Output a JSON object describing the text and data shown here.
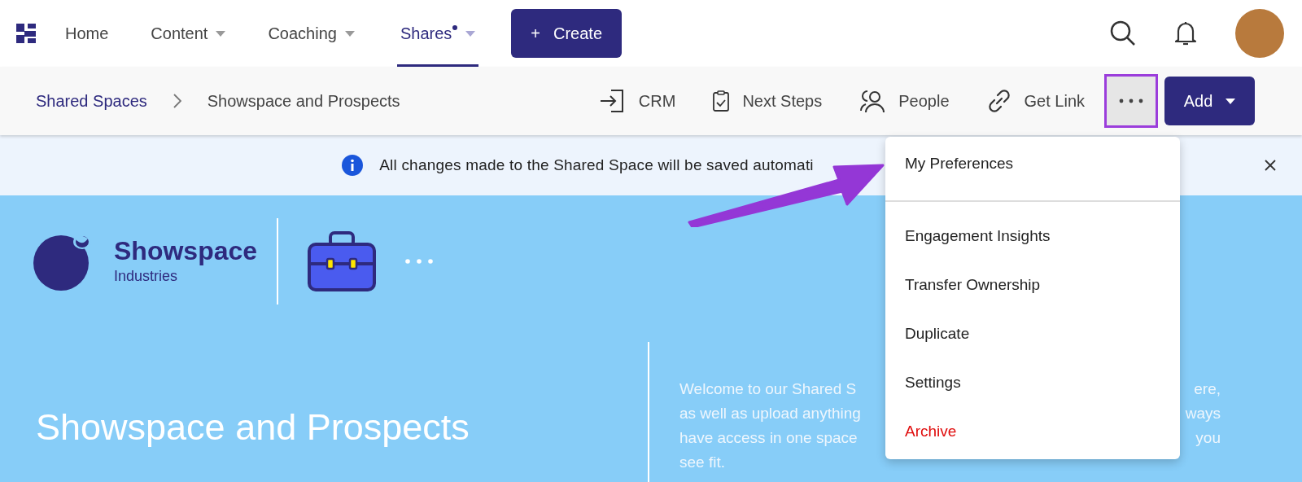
{
  "nav": {
    "items": [
      {
        "label": "Home",
        "selected": false,
        "has_caret": false,
        "dot": false
      },
      {
        "label": "Content",
        "selected": false,
        "has_caret": true,
        "dot": false
      },
      {
        "label": "Coaching",
        "selected": false,
        "has_caret": true,
        "dot": false
      },
      {
        "label": "Shares",
        "selected": true,
        "has_caret": true,
        "dot": true
      }
    ],
    "create_button": {
      "icon": "+",
      "label": "Create"
    }
  },
  "toolbar": {
    "breadcrumbs": [
      "Shared Spaces",
      "Showspace and Prospects"
    ],
    "actions": [
      {
        "kind": "crm",
        "label": "CRM"
      },
      {
        "kind": "steps",
        "label": "Next Steps"
      },
      {
        "kind": "people",
        "label": "People"
      },
      {
        "kind": "link",
        "label": "Get Link"
      }
    ],
    "more_button": {
      "highlighted": true
    },
    "add_button": {
      "label": "Add"
    }
  },
  "banner": {
    "text": "All changes made to the Shared Space will be saved automati"
  },
  "menu": {
    "items": [
      {
        "label": "My Preferences",
        "kind": "normal",
        "divider_after": true
      },
      {
        "label": "Engagement Insights",
        "kind": "normal",
        "divider_after": false
      },
      {
        "label": "Transfer Ownership",
        "kind": "normal",
        "divider_after": false
      },
      {
        "label": "Duplicate",
        "kind": "normal",
        "divider_after": false
      },
      {
        "label": "Settings",
        "kind": "normal",
        "divider_after": false
      },
      {
        "label": "Archive",
        "kind": "danger",
        "divider_after": false
      }
    ]
  },
  "hero": {
    "company_name": "Showspace",
    "company_sub": "Industries",
    "title": "Showspace and Prospects",
    "welcome_lines": [
      {
        "left": "Welcome to our Shared S",
        "right": "ere,"
      },
      {
        "left": "as well as upload anything",
        "right": "ways"
      },
      {
        "left": "have access in one space",
        "right": "you"
      },
      {
        "left": "see fit."
      }
    ]
  }
}
